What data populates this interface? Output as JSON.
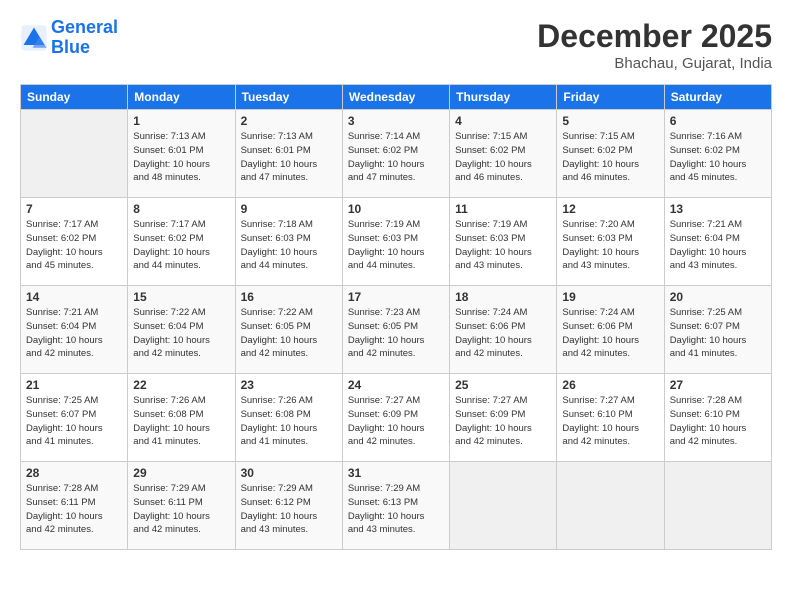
{
  "header": {
    "logo_line1": "General",
    "logo_line2": "Blue",
    "month_year": "December 2025",
    "location": "Bhachau, Gujarat, India"
  },
  "days_of_week": [
    "Sunday",
    "Monday",
    "Tuesday",
    "Wednesday",
    "Thursday",
    "Friday",
    "Saturday"
  ],
  "weeks": [
    [
      {
        "day": "",
        "info": ""
      },
      {
        "day": "1",
        "info": "Sunrise: 7:13 AM\nSunset: 6:01 PM\nDaylight: 10 hours\nand 48 minutes."
      },
      {
        "day": "2",
        "info": "Sunrise: 7:13 AM\nSunset: 6:01 PM\nDaylight: 10 hours\nand 47 minutes."
      },
      {
        "day": "3",
        "info": "Sunrise: 7:14 AM\nSunset: 6:02 PM\nDaylight: 10 hours\nand 47 minutes."
      },
      {
        "day": "4",
        "info": "Sunrise: 7:15 AM\nSunset: 6:02 PM\nDaylight: 10 hours\nand 46 minutes."
      },
      {
        "day": "5",
        "info": "Sunrise: 7:15 AM\nSunset: 6:02 PM\nDaylight: 10 hours\nand 46 minutes."
      },
      {
        "day": "6",
        "info": "Sunrise: 7:16 AM\nSunset: 6:02 PM\nDaylight: 10 hours\nand 45 minutes."
      }
    ],
    [
      {
        "day": "7",
        "info": "Sunrise: 7:17 AM\nSunset: 6:02 PM\nDaylight: 10 hours\nand 45 minutes."
      },
      {
        "day": "8",
        "info": "Sunrise: 7:17 AM\nSunset: 6:02 PM\nDaylight: 10 hours\nand 44 minutes."
      },
      {
        "day": "9",
        "info": "Sunrise: 7:18 AM\nSunset: 6:03 PM\nDaylight: 10 hours\nand 44 minutes."
      },
      {
        "day": "10",
        "info": "Sunrise: 7:19 AM\nSunset: 6:03 PM\nDaylight: 10 hours\nand 44 minutes."
      },
      {
        "day": "11",
        "info": "Sunrise: 7:19 AM\nSunset: 6:03 PM\nDaylight: 10 hours\nand 43 minutes."
      },
      {
        "day": "12",
        "info": "Sunrise: 7:20 AM\nSunset: 6:03 PM\nDaylight: 10 hours\nand 43 minutes."
      },
      {
        "day": "13",
        "info": "Sunrise: 7:21 AM\nSunset: 6:04 PM\nDaylight: 10 hours\nand 43 minutes."
      }
    ],
    [
      {
        "day": "14",
        "info": "Sunrise: 7:21 AM\nSunset: 6:04 PM\nDaylight: 10 hours\nand 42 minutes."
      },
      {
        "day": "15",
        "info": "Sunrise: 7:22 AM\nSunset: 6:04 PM\nDaylight: 10 hours\nand 42 minutes."
      },
      {
        "day": "16",
        "info": "Sunrise: 7:22 AM\nSunset: 6:05 PM\nDaylight: 10 hours\nand 42 minutes."
      },
      {
        "day": "17",
        "info": "Sunrise: 7:23 AM\nSunset: 6:05 PM\nDaylight: 10 hours\nand 42 minutes."
      },
      {
        "day": "18",
        "info": "Sunrise: 7:24 AM\nSunset: 6:06 PM\nDaylight: 10 hours\nand 42 minutes."
      },
      {
        "day": "19",
        "info": "Sunrise: 7:24 AM\nSunset: 6:06 PM\nDaylight: 10 hours\nand 42 minutes."
      },
      {
        "day": "20",
        "info": "Sunrise: 7:25 AM\nSunset: 6:07 PM\nDaylight: 10 hours\nand 41 minutes."
      }
    ],
    [
      {
        "day": "21",
        "info": "Sunrise: 7:25 AM\nSunset: 6:07 PM\nDaylight: 10 hours\nand 41 minutes."
      },
      {
        "day": "22",
        "info": "Sunrise: 7:26 AM\nSunset: 6:08 PM\nDaylight: 10 hours\nand 41 minutes."
      },
      {
        "day": "23",
        "info": "Sunrise: 7:26 AM\nSunset: 6:08 PM\nDaylight: 10 hours\nand 41 minutes."
      },
      {
        "day": "24",
        "info": "Sunrise: 7:27 AM\nSunset: 6:09 PM\nDaylight: 10 hours\nand 42 minutes."
      },
      {
        "day": "25",
        "info": "Sunrise: 7:27 AM\nSunset: 6:09 PM\nDaylight: 10 hours\nand 42 minutes."
      },
      {
        "day": "26",
        "info": "Sunrise: 7:27 AM\nSunset: 6:10 PM\nDaylight: 10 hours\nand 42 minutes."
      },
      {
        "day": "27",
        "info": "Sunrise: 7:28 AM\nSunset: 6:10 PM\nDaylight: 10 hours\nand 42 minutes."
      }
    ],
    [
      {
        "day": "28",
        "info": "Sunrise: 7:28 AM\nSunset: 6:11 PM\nDaylight: 10 hours\nand 42 minutes."
      },
      {
        "day": "29",
        "info": "Sunrise: 7:29 AM\nSunset: 6:11 PM\nDaylight: 10 hours\nand 42 minutes."
      },
      {
        "day": "30",
        "info": "Sunrise: 7:29 AM\nSunset: 6:12 PM\nDaylight: 10 hours\nand 43 minutes."
      },
      {
        "day": "31",
        "info": "Sunrise: 7:29 AM\nSunset: 6:13 PM\nDaylight: 10 hours\nand 43 minutes."
      },
      {
        "day": "",
        "info": ""
      },
      {
        "day": "",
        "info": ""
      },
      {
        "day": "",
        "info": ""
      }
    ]
  ]
}
